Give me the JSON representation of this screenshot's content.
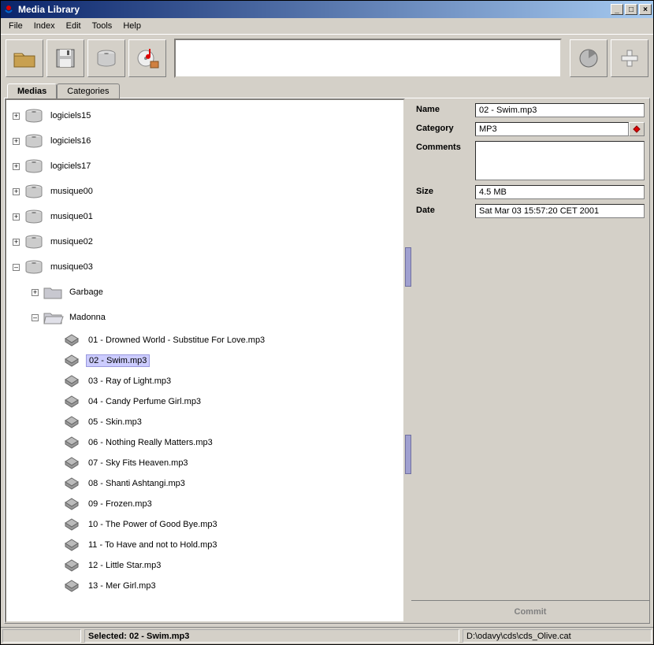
{
  "titlebar": {
    "title": "Media Library"
  },
  "menu": {
    "file": "File",
    "index": "Index",
    "edit": "Edit",
    "tools": "Tools",
    "help": "Help"
  },
  "tabs": {
    "medias": "Medias",
    "categories": "Categories"
  },
  "tree": {
    "volumes": [
      {
        "label": "logiciels15",
        "expanded": false
      },
      {
        "label": "logiciels16",
        "expanded": false
      },
      {
        "label": "logiciels17",
        "expanded": false
      },
      {
        "label": "musique00",
        "expanded": false
      },
      {
        "label": "musique01",
        "expanded": false
      },
      {
        "label": "musique02",
        "expanded": false
      },
      {
        "label": "musique03",
        "expanded": true
      }
    ],
    "folders": [
      {
        "label": "Garbage",
        "expanded": false
      },
      {
        "label": "Madonna",
        "expanded": true
      }
    ],
    "files": [
      "01 - Drowned World - Substitue For Love.mp3",
      "02 - Swim.mp3",
      "03 - Ray of Light.mp3",
      "04 - Candy Perfume Girl.mp3",
      "05 - Skin.mp3",
      "06 - Nothing Really Matters.mp3",
      "07 - Sky Fits Heaven.mp3",
      "08 - Shanti Ashtangi.mp3",
      "09 - Frozen.mp3",
      "10 - The Power of Good Bye.mp3",
      "11 - To Have and not to Hold.mp3",
      "12 - Little Star.mp3",
      "13 - Mer Girl.mp3"
    ],
    "selected_index": 1
  },
  "details": {
    "labels": {
      "name": "Name",
      "category": "Category",
      "comments": "Comments",
      "size": "Size",
      "date": "Date"
    },
    "name": "02 - Swim.mp3",
    "category": "MP3",
    "comments": "",
    "size": "4.5 MB",
    "date": "Sat Mar 03 15:57:20 CET 2001"
  },
  "commit": "Commit",
  "status": {
    "selected": "Selected: 02 - Swim.mp3",
    "path": "D:\\odavy\\cds\\cds_Olive.cat"
  }
}
